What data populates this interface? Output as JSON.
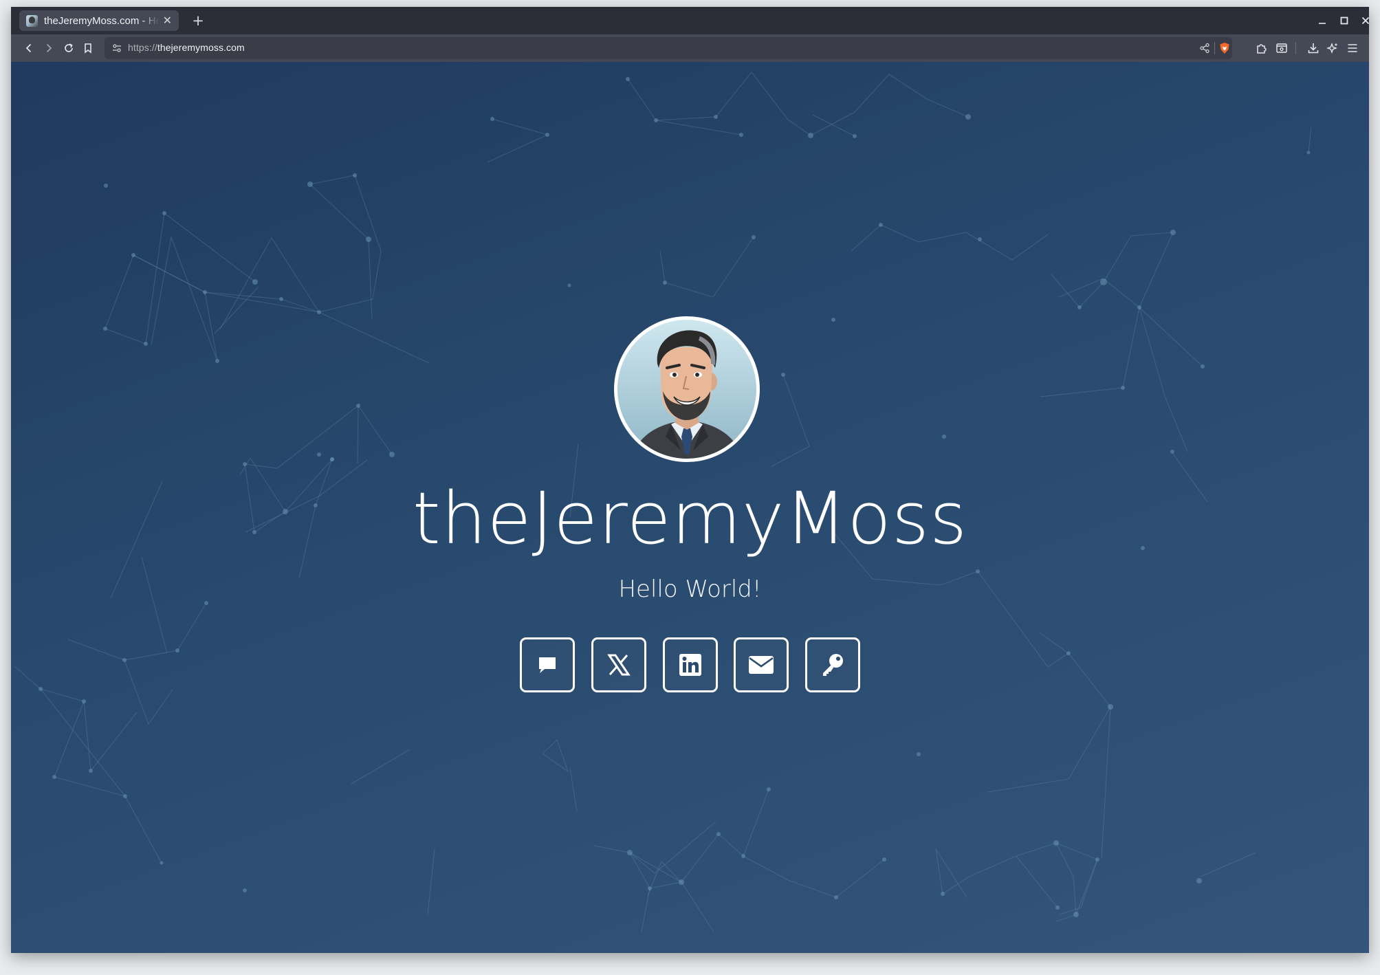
{
  "browser": {
    "tab_title": "theJeremyMoss.com - Hello World!",
    "url_scheme": "https://",
    "url_host": "thejeremymoss.com",
    "accent_shield": "#f36b2a"
  },
  "page": {
    "site_title": "theJeremyMoss",
    "tagline": "Hello World!",
    "social_links": [
      {
        "name": "chat",
        "icon": "chat-bubble-icon"
      },
      {
        "name": "x",
        "icon": "x-logo-icon"
      },
      {
        "name": "linkedin",
        "icon": "linkedin-icon"
      },
      {
        "name": "email",
        "icon": "envelope-icon"
      },
      {
        "name": "key",
        "icon": "key-icon"
      }
    ],
    "colors": {
      "background_top": "#1f3a5e",
      "background_bottom": "#34557a",
      "text": "#ffffff"
    }
  }
}
